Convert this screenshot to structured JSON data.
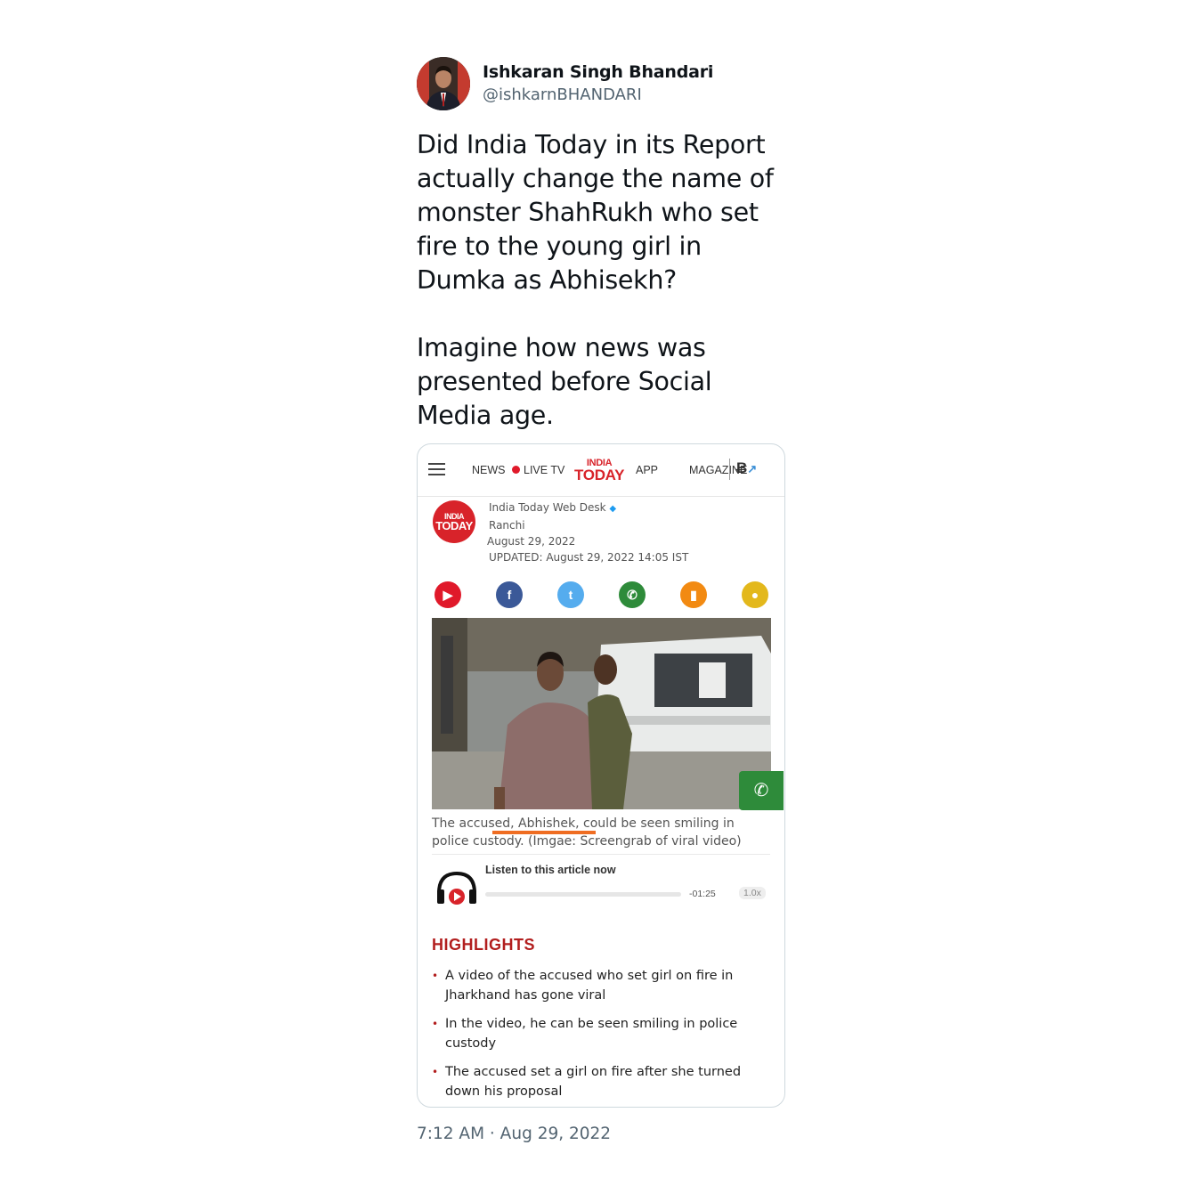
{
  "author": {
    "name": "Ishkaran Singh Bhandari",
    "handle": "@ishkarnBHANDARI"
  },
  "tweet": {
    "text": "Did India Today in its Report actually change the name of monster ShahRukh who set fire to the young girl in Dumka as Abhisekh?\n\nImagine how news was presented before Social Media age.",
    "timestamp": "7:12 AM · Aug 29, 2022"
  },
  "screenshot": {
    "nav": {
      "news": "NEWS",
      "live_tv": "LIVE TV",
      "logo_top": "INDIA",
      "logo_bottom": "TODAY",
      "app": "APP",
      "magazine": "MAGAZINE"
    },
    "byline": {
      "desk": "India Today Web Desk",
      "place": "Ranchi",
      "date": "August 29, 2022",
      "updated": "UPDATED: August 29, 2022 14:05 IST"
    },
    "share_icons": [
      "youtube-icon",
      "facebook-icon",
      "twitter-icon",
      "whatsapp-icon",
      "bookmark-icon",
      "comment-icon"
    ],
    "caption": "The accused, Abhishek, could be seen smiling in police custody. (Imgae: Screengrab of viral video)",
    "audio": {
      "label": "Listen to this article now",
      "time": "-01:25",
      "speed": "1.0x"
    },
    "highlights": {
      "title": "HIGHLIGHTS",
      "items": [
        "A video of the accused who set girl on fire in Jharkhand has gone viral",
        "In the video, he can be seen smiling in police custody",
        "The accused set a girl on fire after she turned down his proposal"
      ]
    },
    "colors": {
      "brand_red": "#d8232a",
      "highlight_underline": "#ef6d22",
      "whatsapp_green": "#2e8b3a"
    }
  }
}
